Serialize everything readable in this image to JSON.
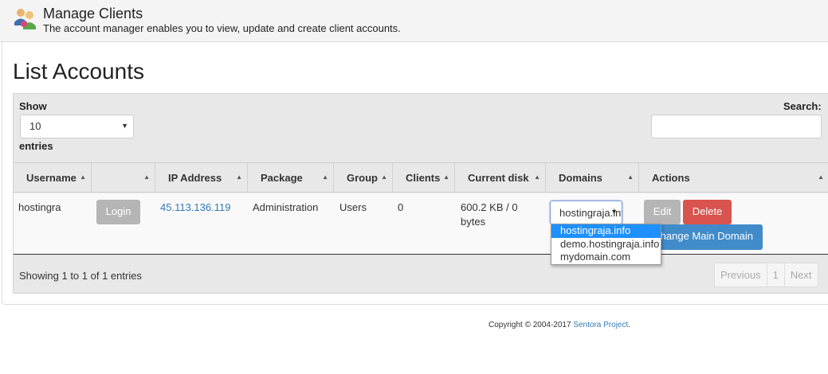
{
  "header": {
    "title": "Manage Clients",
    "subtitle": "The account manager enables you to view, update and create client accounts.",
    "logo_icon": "users-group-icon"
  },
  "page": {
    "title": "List Accounts"
  },
  "controls": {
    "show_label": "Show",
    "page_size": "10",
    "entries_label": "entries",
    "search_label": "Search:",
    "search_value": ""
  },
  "table": {
    "columns": [
      "Username",
      "",
      "IP Address",
      "Package",
      "Group",
      "Clients",
      "Current disk",
      "Domains",
      "Actions"
    ],
    "rows": [
      {
        "username": "hostingra",
        "login_label": "Login",
        "ip": "45.113.136.119",
        "package": "Administration",
        "group": "Users",
        "clients": "0",
        "disk_line1": "600.2 KB / 0",
        "disk_line2": "bytes",
        "domain_selected": "hostingraja.info",
        "domain_options": [
          "hostingraja.info",
          "demo.hostingraja.info",
          "mydomain.com"
        ],
        "edit_label": "Edit",
        "delete_label": "Delete",
        "change_domain_label": "Change Main Domain"
      }
    ]
  },
  "footer_info": "Showing 1 to 1 of 1 entries",
  "pagination": {
    "previous": "Previous",
    "current": "1",
    "next": "Next"
  },
  "copyright": {
    "text": "Copyright © 2004-2017 ",
    "link": "Sentora Project",
    "suffix": "."
  },
  "colors": {
    "link": "#337ab7",
    "delete": "#d9534f",
    "primary": "#428bca",
    "disabled": "#b5b5b5"
  }
}
